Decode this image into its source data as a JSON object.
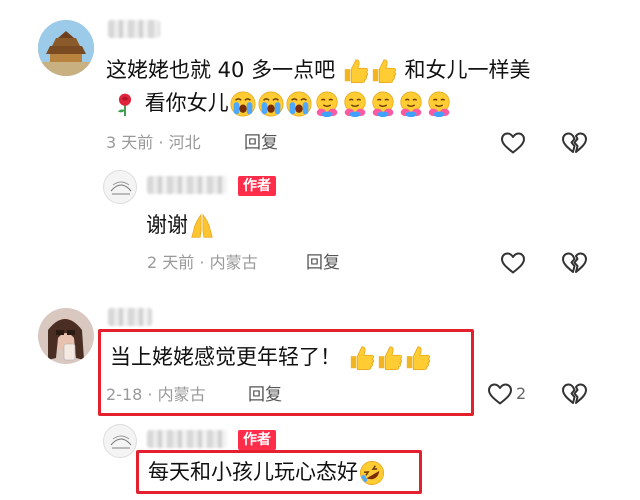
{
  "comments": [
    {
      "text_a": "这姥姥也就 40 多一点吧",
      "text_b": "和女儿一样美",
      "text_c": "看你女儿",
      "time": "3 天前",
      "location": "河北",
      "reply": "回复",
      "emoji": [
        "thumbs-up",
        "thumbs-up",
        "rose",
        "loudly-crying",
        "loudly-crying",
        "loudly-crying",
        "hugging-face",
        "hugging-face",
        "hugging-face",
        "hugging-face",
        "hugging-face"
      ],
      "reply_item": {
        "badge": "作者",
        "text": "谢谢",
        "time": "2 天前",
        "location": "内蒙古",
        "reply": "回复",
        "emoji": [
          "folded-hands"
        ]
      }
    },
    {
      "text": "当上姥姥感觉更年轻了！",
      "time": "2-18",
      "location": "内蒙古",
      "reply": "回复",
      "likes": "2",
      "emoji": [
        "thumbs-up",
        "thumbs-up",
        "thumbs-up"
      ],
      "reply_item": {
        "badge": "作者",
        "text": "每天和小孩儿玩心态好",
        "emoji": [
          "rolling-laughing"
        ]
      }
    }
  ],
  "separator": "·",
  "colors": {
    "badge": "#ff2d4a",
    "highlight": "#e4202e",
    "meta": "#999999"
  }
}
